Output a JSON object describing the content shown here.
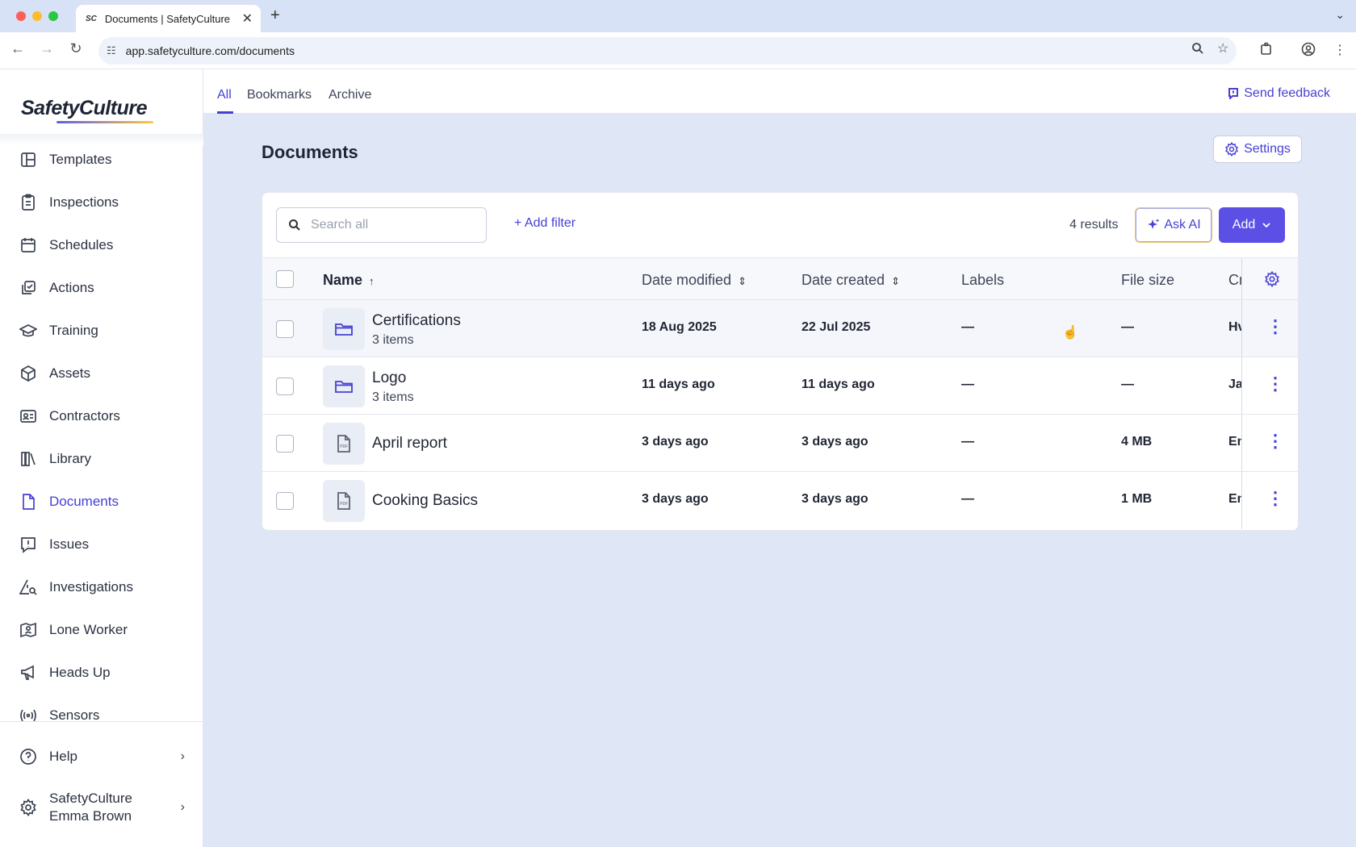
{
  "browser": {
    "tab_title": "Documents | SafetyCulture",
    "favicon_text": "SC",
    "url": "app.safetyculture.com/documents"
  },
  "sidebar": {
    "logo": "SafetyCulture",
    "items": [
      {
        "label": "Templates",
        "icon": "templates-icon"
      },
      {
        "label": "Inspections",
        "icon": "inspections-icon"
      },
      {
        "label": "Schedules",
        "icon": "schedules-icon"
      },
      {
        "label": "Actions",
        "icon": "actions-icon"
      },
      {
        "label": "Training",
        "icon": "training-icon"
      },
      {
        "label": "Assets",
        "icon": "assets-icon"
      },
      {
        "label": "Contractors",
        "icon": "contractors-icon"
      },
      {
        "label": "Library",
        "icon": "library-icon"
      },
      {
        "label": "Documents",
        "icon": "documents-icon",
        "active": true
      },
      {
        "label": "Issues",
        "icon": "issues-icon"
      },
      {
        "label": "Investigations",
        "icon": "investigations-icon"
      },
      {
        "label": "Lone Worker",
        "icon": "lone-worker-icon"
      },
      {
        "label": "Heads Up",
        "icon": "heads-up-icon"
      },
      {
        "label": "Sensors",
        "icon": "sensors-icon"
      }
    ],
    "help_label": "Help",
    "org_name": "SafetyCulture",
    "user_name": "Emma Brown"
  },
  "top_tabs": {
    "all": "All",
    "bookmarks": "Bookmarks",
    "archive": "Archive",
    "feedback": "Send feedback"
  },
  "page": {
    "title": "Documents",
    "settings_label": "Settings"
  },
  "toolbar": {
    "search_placeholder": "Search all",
    "add_filter": "+ Add filter",
    "results": "4 results",
    "ask_ai": "Ask AI",
    "add": "Add"
  },
  "table": {
    "columns": {
      "name": "Name",
      "date_modified": "Date modified",
      "date_created": "Date created",
      "labels": "Labels",
      "file_size": "File size",
      "creator": "Cr"
    },
    "rows": [
      {
        "name": "Certifications",
        "sub": "3 items",
        "type": "folder",
        "modified": "18 Aug 2025",
        "created": "22 Jul 2025",
        "labels": "—",
        "size": "—",
        "creator": "Hv"
      },
      {
        "name": "Logo",
        "sub": "3 items",
        "type": "folder",
        "modified": "11 days ago",
        "created": "11 days ago",
        "labels": "—",
        "size": "—",
        "creator": "Jar"
      },
      {
        "name": "April report",
        "sub": "",
        "type": "pdf",
        "modified": "3 days ago",
        "created": "3 days ago",
        "labels": "—",
        "size": "4 MB",
        "creator": "En"
      },
      {
        "name": "Cooking Basics",
        "sub": "",
        "type": "pdf",
        "modified": "3 days ago",
        "created": "3 days ago",
        "labels": "—",
        "size": "1 MB",
        "creator": "En"
      }
    ]
  },
  "colors": {
    "accent": "#4740d4",
    "primary_button": "#5b4fe6",
    "page_bg": "#dfe6f5"
  }
}
